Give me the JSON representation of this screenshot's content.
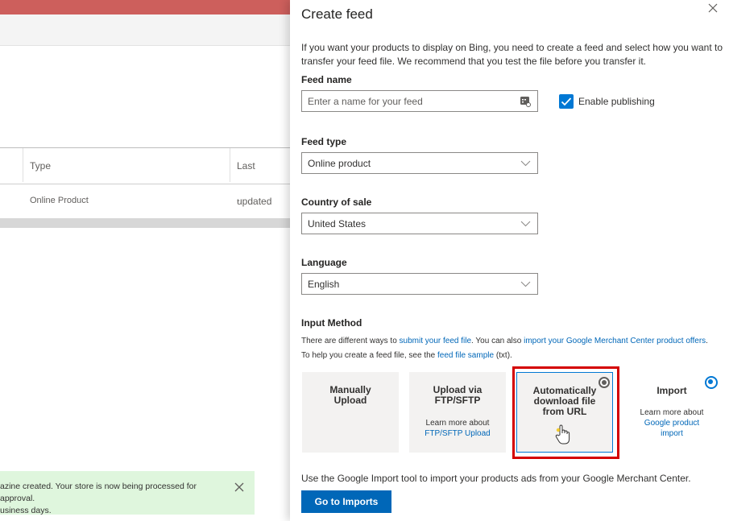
{
  "background": {
    "table": {
      "columns": [
        "Type",
        "Last updated"
      ],
      "row": [
        "Online Product",
        "-"
      ]
    },
    "toast": {
      "line1": "azine created. Your store is now being processed for approval.",
      "line2": "usiness days."
    }
  },
  "panel": {
    "title": "Create feed",
    "intro": "If you want your products to display on Bing, you need to create a feed and select how you want to transfer your feed file. We recommend that you test the file before you transfer it.",
    "feed_name": {
      "label": "Feed name",
      "placeholder": "Enter a name for your feed"
    },
    "enable_publishing": {
      "label": "Enable publishing",
      "checked": true
    },
    "feed_type": {
      "label": "Feed type",
      "value": "Online product"
    },
    "country": {
      "label": "Country of sale",
      "value": "United States"
    },
    "language": {
      "label": "Language",
      "value": "English"
    },
    "input_method": {
      "label": "Input Method",
      "hint1_a": "There are different ways to ",
      "hint1_link1": "submit your feed file",
      "hint1_b": ". You can also ",
      "hint1_link2": "import your Google Merchant Center product offers",
      "hint1_c": ".",
      "hint2_a": "To help you create a feed file, see the ",
      "hint2_link": "feed file sample",
      "hint2_b": " (txt).",
      "options": [
        {
          "title": "Manually Upload"
        },
        {
          "title": "Upload via FTP/SFTP",
          "learn": "Learn more about",
          "link": "FTP/SFTP Upload"
        },
        {
          "title": "Automatically download file from URL"
        },
        {
          "title": "Import",
          "learn": "Learn more about",
          "link": "Google product import"
        }
      ]
    },
    "footer_note": "Use the Google Import tool to import your products ads from your Google Merchant Center.",
    "go_button": "Go to Imports"
  },
  "colors": {
    "accent": "#0078d4",
    "highlight": "#d40000",
    "topbar": "#cd5f5c",
    "toast": "#dff6dd"
  }
}
